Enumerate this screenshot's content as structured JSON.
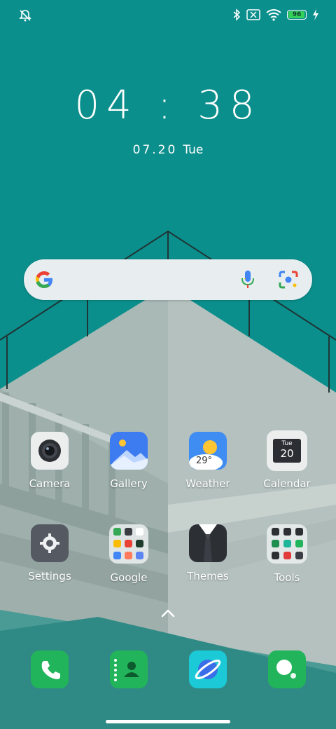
{
  "status_bar": {
    "battery_level": "96",
    "icons": [
      "do-not-disturb-icon",
      "bluetooth-icon",
      "no-sim-icon",
      "wifi-icon",
      "battery-icon",
      "charging-icon"
    ]
  },
  "clock": {
    "time": "04 : 38",
    "date": "07.20",
    "day": "Tue"
  },
  "search": {
    "icons": [
      "google-logo",
      "mic-icon",
      "lens-icon"
    ]
  },
  "apps": [
    {
      "label": "Camera"
    },
    {
      "label": "Gallery"
    },
    {
      "label": "Weather",
      "temperature": "29°"
    },
    {
      "label": "Calendar",
      "day": "Tue",
      "date": "20"
    },
    {
      "label": "Settings"
    },
    {
      "label": "Google"
    },
    {
      "label": "Themes"
    },
    {
      "label": "Tools"
    }
  ],
  "dock": [
    {
      "name": "Phone"
    },
    {
      "name": "Contacts"
    },
    {
      "name": "Browser"
    },
    {
      "name": "Messages"
    }
  ],
  "colors": {
    "wallpaper": "#0b8f8c",
    "dock_green": "#22b45a",
    "accent_blue": "#3a7de0"
  }
}
